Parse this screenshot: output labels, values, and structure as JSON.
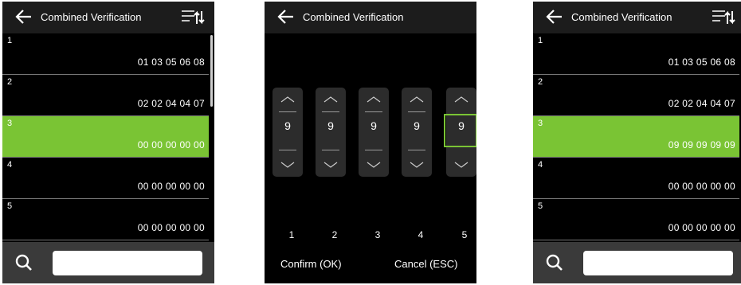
{
  "screen1": {
    "title": "Combined Verification",
    "rows": [
      {
        "num": "1",
        "value": "01 03 05 06 08"
      },
      {
        "num": "2",
        "value": "02 02 04 04 07"
      },
      {
        "num": "3",
        "value": "00 00 00 00 00"
      },
      {
        "num": "4",
        "value": "00 00 00 00 00"
      },
      {
        "num": "5",
        "value": "00 00 00 00 00"
      }
    ],
    "selected_row": "3",
    "search_value": ""
  },
  "screen2": {
    "title": "Combined Verification",
    "digits": [
      "9",
      "9",
      "9",
      "9",
      "9"
    ],
    "column_labels": [
      "1",
      "2",
      "3",
      "4",
      "5"
    ],
    "focused_column": "5",
    "confirm_label": "Confirm (OK)",
    "cancel_label": "Cancel (ESC)"
  },
  "screen3": {
    "title": "Combined Verification",
    "rows": [
      {
        "num": "1",
        "value": "01 03 05 06 08"
      },
      {
        "num": "2",
        "value": "02 02 04 04 07"
      },
      {
        "num": "3",
        "value": "09 09 09 09 09"
      },
      {
        "num": "4",
        "value": "00 00 00 00 00"
      },
      {
        "num": "5",
        "value": "00 00 00 00 00"
      }
    ],
    "selected_row": "3",
    "search_value": ""
  },
  "colors": {
    "accent": "#7ac434",
    "background": "#000000",
    "header": "#1c1c1c",
    "footer": "#3a3a3a"
  },
  "icons": [
    "back-arrow-icon",
    "sort-icon",
    "search-icon",
    "chevron-up-icon",
    "chevron-down-icon"
  ]
}
